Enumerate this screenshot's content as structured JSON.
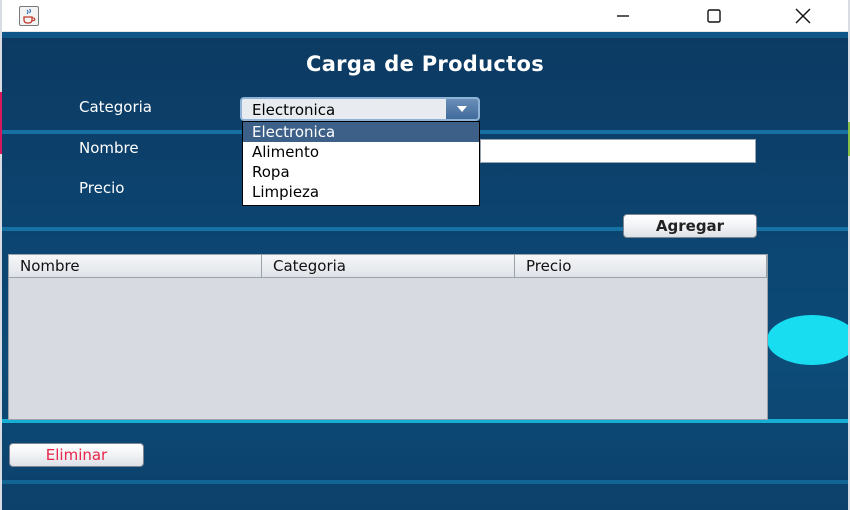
{
  "window": {
    "title_icon": "java-cup-icon",
    "controls": [
      "minimize-icon",
      "maximize-icon",
      "close-icon"
    ]
  },
  "form": {
    "title": "Carga de Productos",
    "labels": {
      "categoria": "Categoria",
      "nombre": "Nombre",
      "precio": "Precio"
    },
    "category_select": {
      "selected": "Electronica",
      "options": [
        "Electronica",
        "Alimento",
        "Ropa",
        "Limpieza"
      ],
      "open": true
    },
    "nombre_value": "",
    "precio_value": ""
  },
  "buttons": {
    "agregar": "Agregar",
    "eliminar": "Eliminar"
  },
  "table": {
    "columns": [
      "Nombre",
      "Categoria",
      "Precio"
    ],
    "rows": []
  },
  "colors": {
    "background": "#0c4470",
    "accent_stripe": "#1a82b4",
    "selection": "#3d6089",
    "delete_text": "#e8244a",
    "deco_circle": "#18dcf0"
  }
}
